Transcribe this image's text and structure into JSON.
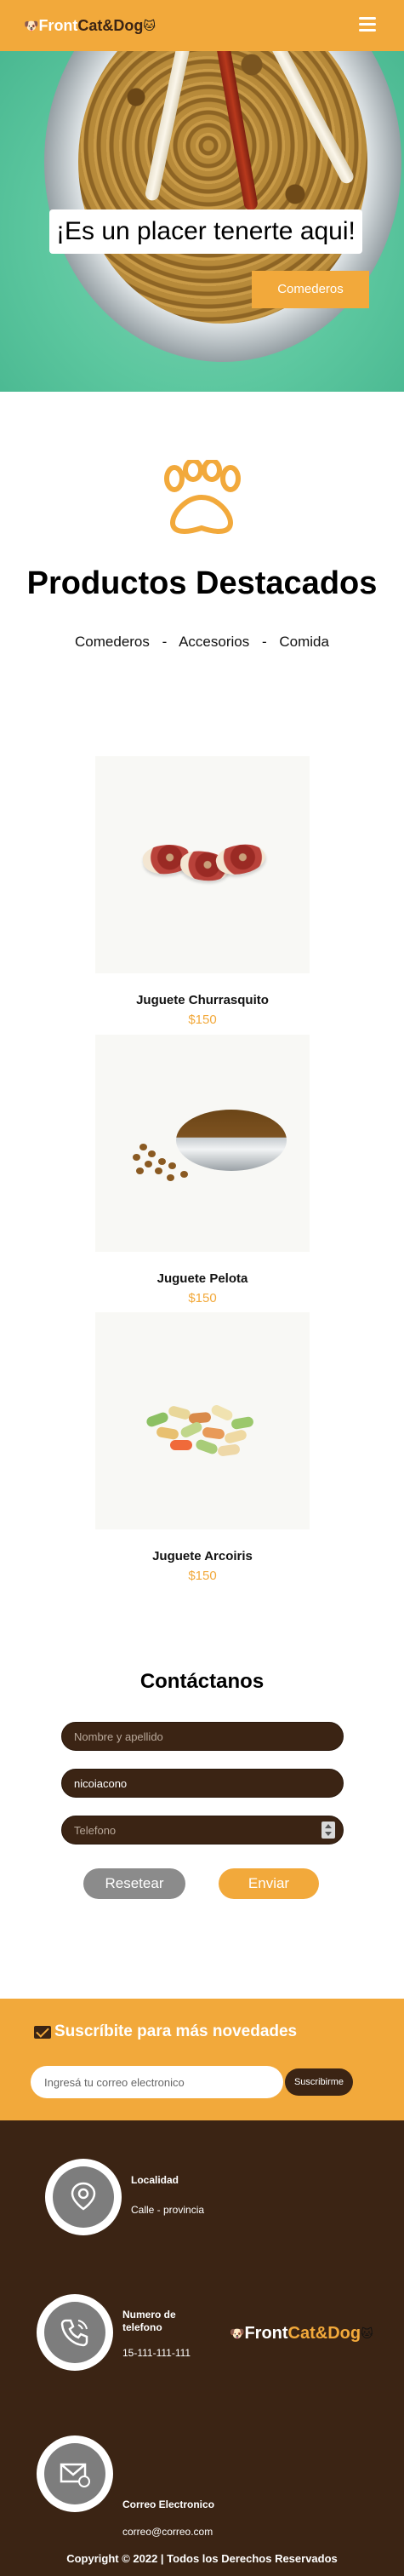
{
  "header": {
    "logo_part1": "Front",
    "logo_part2": "Cat&Dog",
    "menu_icon": "hamburger-menu-icon"
  },
  "hero": {
    "title": "¡Es un placer tenerte aqui!",
    "button_label": "Comederos"
  },
  "featured": {
    "icon": "paw-icon",
    "title": "Productos Destacados",
    "filters": [
      "Comederos",
      "Accesorios",
      "Comida"
    ],
    "separator": "-"
  },
  "products": [
    {
      "name": "Juguete Churrasquito",
      "price": "$150"
    },
    {
      "name": "Juguete Pelota",
      "price": "$150"
    },
    {
      "name": "Juguete Arcoiris",
      "price": "$150"
    }
  ],
  "contact": {
    "title": "Contáctanos",
    "name_placeholder": "Nombre y apellido",
    "user_value": "nicoiacono",
    "phone_placeholder": "Telefono",
    "reset_label": "Resetear",
    "send_label": "Enviar"
  },
  "newsletter": {
    "title": "Suscríbite para más novedades",
    "input_placeholder": "Ingresá tu correo electronico",
    "button_label": "Suscribirme"
  },
  "footer": {
    "location_label": "Localidad",
    "location_value": "Calle - provincia",
    "phone_label": "Numero de telefono",
    "phone_value": "15-111-111-111",
    "email_label": "Correo Electronico",
    "email_value": "correo@correo.com",
    "logo_part1": "Front",
    "logo_part2": "Cat&Dog",
    "copyright": "Copyright © 2022 | Todos los Derechos Reservados"
  },
  "colors": {
    "accent": "#f2a93b",
    "dark_brown": "#3b2414",
    "grey": "#8b8b8b"
  }
}
